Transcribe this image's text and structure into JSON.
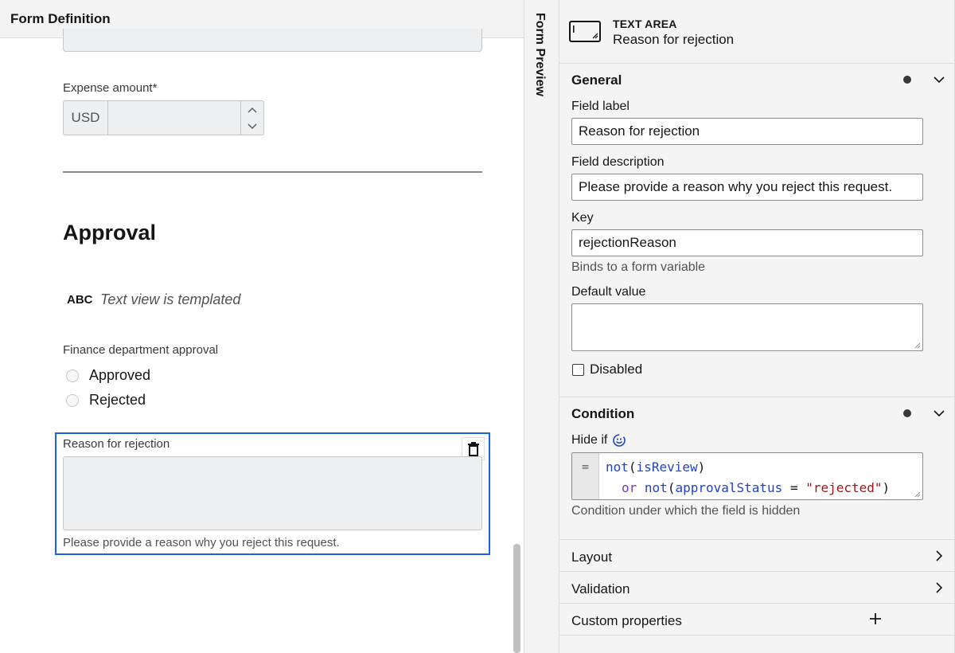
{
  "left_pane": {
    "header_title": "Form Definition",
    "expense_label": "Expense amount*",
    "currency_prefix": "USD",
    "approval_heading": "Approval",
    "text_view_badge": "ABC",
    "text_view_label": "Text view is templated",
    "finance_label": "Finance department approval",
    "radio_options": [
      "Approved",
      "Rejected"
    ],
    "selected_field": {
      "label": "Reason for rejection",
      "description": "Please provide a reason why you reject this request."
    }
  },
  "vertical_tab": {
    "label": "Form Preview"
  },
  "properties": {
    "type_title": "TEXT AREA",
    "type_subtitle": "Reason for rejection",
    "general": {
      "heading": "General",
      "field_label_label": "Field label",
      "field_label_value": "Reason for rejection",
      "field_description_label": "Field description",
      "field_description_value": "Please provide a reason why you reject this request.",
      "key_label": "Key",
      "key_value": "rejectionReason",
      "key_help": "Binds to a form variable",
      "default_value_label": "Default value",
      "default_value": "",
      "disabled_label": "Disabled"
    },
    "condition": {
      "heading": "Condition",
      "hide_if_label": "Hide if",
      "gutter": "=",
      "help": "Condition under which the field is hidden"
    },
    "collapsed_sections": [
      "Layout",
      "Validation",
      "Custom properties"
    ]
  },
  "colors": {
    "selection_blue": "#1a64e3",
    "feel_icon": "#1f43c9"
  }
}
